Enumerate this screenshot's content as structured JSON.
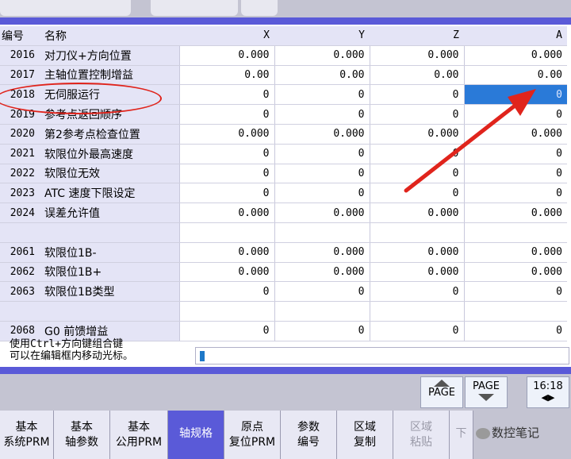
{
  "header": {
    "columns": {
      "no": "编号",
      "name": "名称",
      "x": "X",
      "y": "Y",
      "z": "Z",
      "a": "A"
    }
  },
  "rows": [
    {
      "no": "2016",
      "name": "对刀仪+方向位置",
      "x": "0.000",
      "y": "0.000",
      "z": "0.000",
      "a": "0.000"
    },
    {
      "no": "2017",
      "name": "主轴位置控制增益",
      "x": "0.00",
      "y": "0.00",
      "z": "0.00",
      "a": "0.00"
    },
    {
      "no": "2018",
      "name": "无伺服运行",
      "x": "0",
      "y": "0",
      "z": "0",
      "a": "0",
      "selected": "a"
    },
    {
      "no": "2019",
      "name": "参考点返回顺序",
      "x": "0",
      "y": "0",
      "z": "0",
      "a": "0"
    },
    {
      "no": "2020",
      "name": "第2参考点检查位置",
      "x": "0.000",
      "y": "0.000",
      "z": "0.000",
      "a": "0.000"
    },
    {
      "no": "2021",
      "name": "软限位外最高速度",
      "x": "0",
      "y": "0",
      "z": "0",
      "a": "0"
    },
    {
      "no": "2022",
      "name": "软限位无效",
      "x": "0",
      "y": "0",
      "z": "0",
      "a": "0"
    },
    {
      "no": "2023",
      "name": "ATC 速度下限设定",
      "x": "0",
      "y": "0",
      "z": "0",
      "a": "0"
    },
    {
      "no": "2024",
      "name": "误差允许值",
      "x": "0.000",
      "y": "0.000",
      "z": "0.000",
      "a": "0.000"
    },
    {
      "no": "",
      "name": "",
      "x": "",
      "y": "",
      "z": "",
      "a": ""
    },
    {
      "no": "2061",
      "name": "软限位1B-",
      "x": "0.000",
      "y": "0.000",
      "z": "0.000",
      "a": "0.000"
    },
    {
      "no": "2062",
      "name": "软限位1B+",
      "x": "0.000",
      "y": "0.000",
      "z": "0.000",
      "a": "0.000"
    },
    {
      "no": "2063",
      "name": "软限位1B类型",
      "x": "0",
      "y": "0",
      "z": "0",
      "a": "0"
    },
    {
      "no": "",
      "name": "",
      "x": "",
      "y": "",
      "z": "",
      "a": ""
    },
    {
      "no": "2068",
      "name": "G0 前馈增益",
      "x": "0",
      "y": "0",
      "z": "0",
      "a": "0"
    }
  ],
  "hint": {
    "line1": "使用Ctrl+方向键组合键",
    "line2": "可以在编辑框内移动光标。"
  },
  "edit_box": {
    "value": ""
  },
  "paging": {
    "page_up_label": "PAGE",
    "page_down_label": "PAGE",
    "clock": "16:18"
  },
  "softkeys": [
    {
      "line1": "基本",
      "line2": "系统PRM",
      "state": "normal"
    },
    {
      "line1": "基本",
      "line2": "轴参数",
      "state": "normal"
    },
    {
      "line1": "基本",
      "line2": "公用PRM",
      "state": "normal"
    },
    {
      "line1": "轴规格",
      "line2": "",
      "state": "active"
    },
    {
      "line1": "原点",
      "line2": "复位PRM",
      "state": "normal"
    },
    {
      "line1": "参数",
      "line2": "编号",
      "state": "normal"
    },
    {
      "line1": "区域",
      "line2": "复制",
      "state": "normal"
    },
    {
      "line1": "区域",
      "line2": "粘贴",
      "state": "disabled"
    },
    {
      "line1": "下",
      "line2": "",
      "state": "disabled"
    }
  ],
  "watermark": "数控笔记",
  "colors": {
    "accent": "#5a5ad8",
    "selected_cell": "#2a7ad8",
    "annotation_red": "#e0241c"
  }
}
